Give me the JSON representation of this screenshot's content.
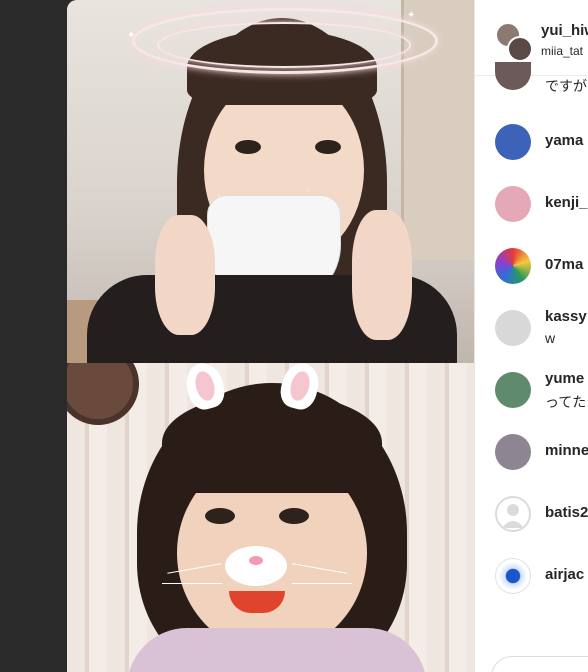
{
  "header": {
    "host_username": "yui_hiw",
    "guest_username": "miia_tat"
  },
  "comments": {
    "partial_text": "ですが",
    "items": [
      {
        "username": "yama",
        "text": "",
        "avatar_icon": "dragon-avatar-icon",
        "avatar_color": "#3d63b8"
      },
      {
        "username": "kenji_",
        "text": "",
        "avatar_icon": "person-photo-avatar",
        "avatar_color": "#e4a8b6"
      },
      {
        "username": "07ma",
        "text": "",
        "avatar_icon": "colorful-ball-avatar",
        "avatar_color": "#2b9a5e"
      },
      {
        "username": "kassy",
        "text": "w",
        "avatar_icon": "shirt-avatar-icon",
        "avatar_color": "#d8d8d8"
      },
      {
        "username": "yume",
        "text": "ってた",
        "avatar_icon": "green-photo-avatar",
        "avatar_color": "#5f8a6c"
      },
      {
        "username": "minne",
        "text": "",
        "avatar_icon": "person-photo-avatar",
        "avatar_color": "#8d8592"
      },
      {
        "username": "batis2",
        "text": "",
        "avatar_icon": "default-user-icon",
        "avatar_color": "#dbdbdb"
      },
      {
        "username": "airjac",
        "text": "",
        "avatar_icon": "blue-dot-avatar",
        "avatar_color": "#1a56c9"
      }
    ]
  },
  "colors": {
    "panel_bg": "#ffffff",
    "text": "#262626",
    "backdrop": "#2a2a2a"
  }
}
